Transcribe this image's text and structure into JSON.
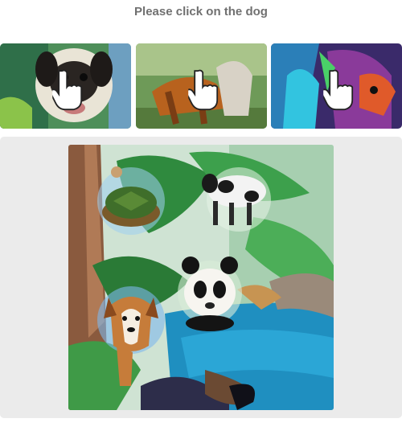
{
  "prompt": {
    "text": "Please click on the dog"
  },
  "examples": [
    {
      "subject": "dog",
      "hint_icon": "pointing-hand-icon"
    },
    {
      "subject": "dog",
      "hint_icon": "pointing-hand-icon"
    },
    {
      "subject": "dog",
      "hint_icon": "pointing-hand-icon"
    }
  ],
  "challenge": {
    "objects": [
      "turtle",
      "cow",
      "panda",
      "dog"
    ]
  },
  "footer": {
    "left_text": "",
    "indicator_color": "#2a8a80"
  }
}
